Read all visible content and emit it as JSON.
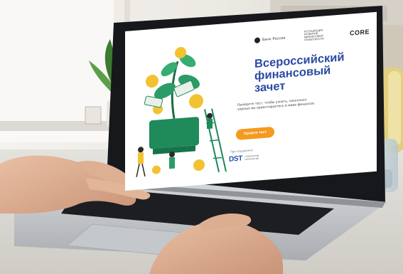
{
  "screen_page": {
    "logos": {
      "central_bank": "Банк России",
      "middle_org": "АССОЦИАЦИЯ РАЗВИТИЯ ФИНАНСОВОЙ ГРАМОТНОСТИ",
      "core": "CORE"
    },
    "headline": [
      "Всероссийский",
      "финансовый",
      "зачет"
    ],
    "subtext": "Пройдите тест, чтобы узнать, насколько хорошо вы ориентируетесь в мире финансов.",
    "cta_label": "Пройти тест",
    "support_label": "При поддержке",
    "partner": {
      "mark": "DST",
      "subtitle": "ГЛОБАЛЬНЫЕ ТЕХНОЛОГИИ"
    }
  },
  "colors": {
    "headline": "#2b4aa3",
    "cta": "#f39a1f",
    "illustration_green": "#1f8a5a",
    "illustration_yellow": "#f2c230",
    "laptop_frame": "#16181b",
    "laptop_body": "#c9cccf"
  }
}
